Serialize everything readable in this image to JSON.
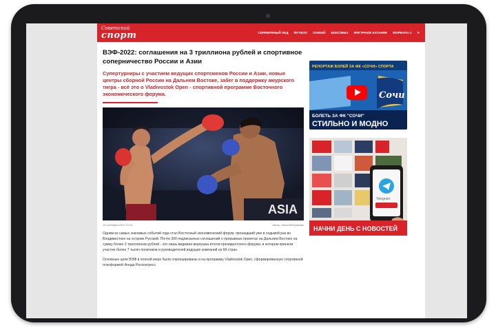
{
  "site": {
    "logo_line1": "Советский",
    "logo_line2": "спорт",
    "nav": [
      "Серебряный лед",
      "Футбол",
      "Хоккей",
      "Бокс/ММА",
      "Фигурное катание",
      "Формула-1",
      "»"
    ]
  },
  "article": {
    "title": "ВЭФ-2022: соглашения на 3 триллиона рублей и спортивное соперничество России и Азии",
    "lead": "Супертурниры с участием ведущих спортсменов России и Азии, новые центры сборной России на Дальнем Востоке, забег в поддержку амурского тигра - всё это о Vladivostok Open - спортивной программе Восточного экономического форума.",
    "date": "16 сентября 2022 22:41",
    "author": "автор: Николай Бражник",
    "photo_trunks_text": "ASIA",
    "paragraphs": [
      "Одним из самых значимых событий года стал Восточный экономический форум, прошедший уже в седьмой раз во Владивостоке на острове Русский. Почти 300 подписанных соглашений о прорывных проектах на Дальнем Востоке на сумму более 3 триллионов рублей - это лишь видимая верхушка итогов президентского форума, в котором приняли участие более 7 тысяч политиков и руководителей ведущих компаний из 68 стран.",
      "Основные цели ВЭФ в полной мере были спроецированы и на программу Vladivostok Open, сформированную спортивной платформой Фонда Росконгресс"
    ]
  },
  "ads": {
    "ad1_top": "РЕПОРТАЖ БОЛЕЙ ЗА ФК «СОЧИ» СПОРТА",
    "ad1_badge": "Сочи",
    "ad1_line1": "БОЛЕТЬ ЗА ФК \"СОЧИ\"",
    "ad1_line2": "СТИЛЬНО И МОДНО",
    "ad2_phone": "Telegram",
    "ad2_bottom": "НАЧНИ ДЕНЬ С НОВОСТЕЙ"
  },
  "colors": {
    "brand": "#d8232a"
  }
}
